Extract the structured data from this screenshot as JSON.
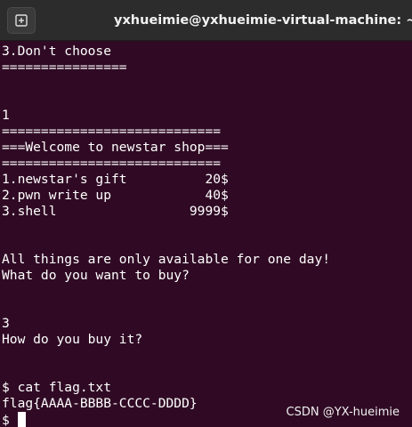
{
  "window": {
    "title": "yxhueimie@yxhueimie-virtual-machine: ~/Down",
    "new_tab_icon": "new-tab-icon"
  },
  "terminal": {
    "lines": [
      "3.Don't choose",
      "================",
      "",
      "",
      "1",
      "============================",
      "===Welcome to newstar shop===",
      "============================",
      "1.newstar's gift          20$",
      "2.pwn write up            40$",
      "3.shell                 9999$",
      "",
      "",
      "All things are only available for one day!",
      "What do you want to buy?",
      "",
      "",
      "3",
      "How do you buy it?",
      "",
      "",
      "$ cat flag.txt",
      "flag{AAAA-BBBB-CCCC-DDDD}",
      "$"
    ]
  },
  "watermark": {
    "text": "CSDN @YX-hueimie"
  },
  "colors": {
    "terminal_bg": "#300a24",
    "titlebar_bg": "#2c2c2c",
    "text": "#ffffff"
  }
}
